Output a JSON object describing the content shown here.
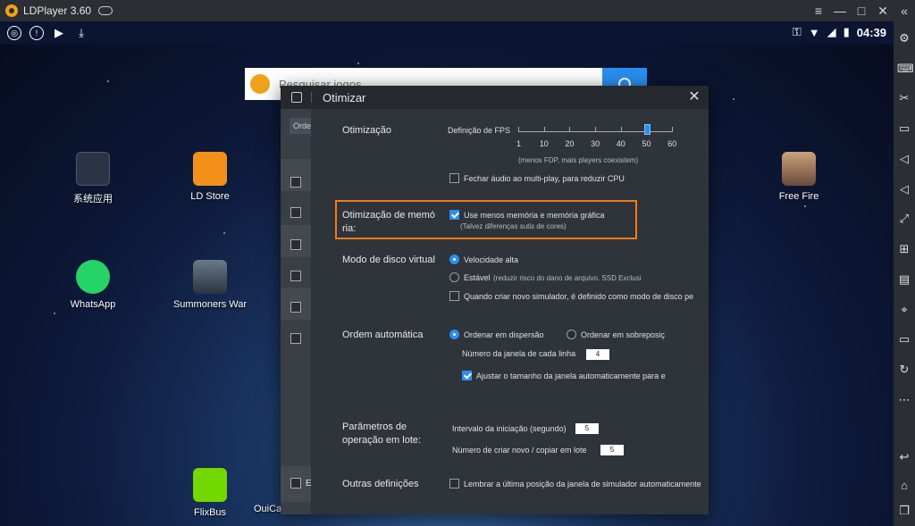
{
  "window": {
    "title": "LDPlayer 3.60",
    "controls": [
      "≡",
      "—",
      "□",
      "✕",
      "«"
    ]
  },
  "status_bar": {
    "time": "04:39"
  },
  "search": {
    "placeholder": "Pesquisar jogos"
  },
  "desktop_apps": [
    {
      "label": "系统应用",
      "icon": "system-apps-icon"
    },
    {
      "label": "LD Store",
      "icon": "ld-store-icon"
    },
    {
      "label": "WhatsApp",
      "icon": "whatsapp-icon"
    },
    {
      "label": "Summoners War",
      "icon": "summoners-war-icon"
    },
    {
      "label": "Free Fire",
      "icon": "free-fire-icon"
    },
    {
      "label": "FlixBus",
      "icon": "flixbus-icon"
    },
    {
      "label": "OuiCar : l",
      "icon": "ouicar-icon"
    }
  ],
  "dialog": {
    "title": "Otimizar",
    "left_panel": {
      "ordem_label": "Orde",
      "last_label": "E"
    },
    "sections": {
      "optimization": {
        "label": "Otimização",
        "fps_label": "Definição de FPS",
        "fps_values": [
          "1",
          "10",
          "20",
          "30",
          "40",
          "50",
          "60"
        ],
        "fps_selected": 50,
        "fps_hint": "(menos FDP, mais players coexistem)",
        "mute_audio": {
          "label": "Fechar áudio ao multi-play, para reduzir CPU",
          "checked": false
        }
      },
      "memory": {
        "label": "Otimização de memó ria:",
        "use_less_memory": {
          "label": "Use menos memória e memória gráfica",
          "checked": true
        },
        "hint": "(Talvez diferenças sutis de cores)"
      },
      "disk": {
        "label": "Modo de disco virtual",
        "high_speed": {
          "label": "Velocidade alta",
          "selected": true
        },
        "stable": {
          "label": "Estável",
          "selected": false,
          "hint": "(reduzir risco do dano de arquivo. SSD Exclusi"
        },
        "new_sim": {
          "label": "Quando criar novo simulador, é definido como modo  de disco pe",
          "checked": false
        }
      },
      "auto_order": {
        "label": "Ordem automática",
        "dispersion": {
          "label": "Ordenar em dispersão",
          "selected": true
        },
        "overlap": {
          "label": "Ordenar em sobreposiç",
          "selected": false
        },
        "windows_per_row_label": "Número da janela de cada linha",
        "windows_per_row_value": "4",
        "auto_resize": {
          "label": "Ajustar o tamanho da janela automaticamente para e",
          "checked": true
        }
      },
      "batch": {
        "label": "Parâmetros de operação em lote:",
        "start_interval_label": "Intervalo da iniciação (segundo)",
        "start_interval_value": "5",
        "create_count_label": "Número de criar novo / copiar em lote",
        "create_count_value": "5"
      },
      "other": {
        "label": "Outras definições",
        "remember_pos": {
          "label": "Lembrar a última posição da janela de simulador automaticamente",
          "checked": false
        }
      }
    }
  },
  "colors": {
    "accent": "#2a8ff0",
    "highlight": "#ef7c1a",
    "dialog_bg": "#2f333a",
    "chrome": "#2b2e33"
  }
}
